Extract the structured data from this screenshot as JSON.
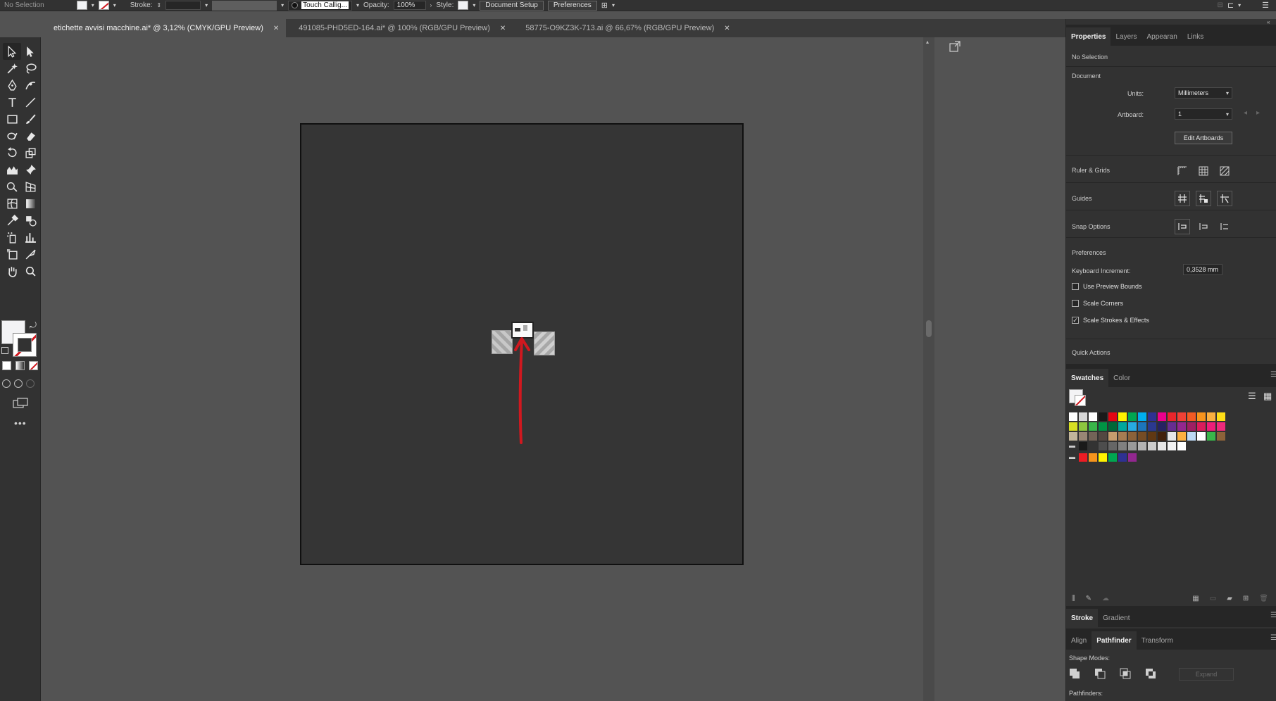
{
  "control_bar": {
    "selection": "No Selection",
    "stroke_label": "Stroke:",
    "brush_label": "Touch Callig...",
    "opacity_label": "Opacity:",
    "opacity_value": "100%",
    "style_label": "Style:",
    "document_setup": "Document Setup",
    "preferences": "Preferences"
  },
  "tabs": [
    {
      "label": "etichette avvisi macchine.ai* @ 3,12% (CMYK/GPU Preview)",
      "active": true
    },
    {
      "label": "491085-PHD5ED-164.ai* @ 100% (RGB/GPU Preview)",
      "active": false
    },
    {
      "label": "58775-O9KZ3K-713.ai @ 66,67% (RGB/GPU Preview)",
      "active": false
    }
  ],
  "panel": {
    "tabs": [
      "Properties",
      "Layers",
      "Appearan",
      "Links"
    ],
    "selection_status": "No Selection",
    "document_title": "Document",
    "units_label": "Units:",
    "units_value": "Millimeters",
    "artboard_label": "Artboard:",
    "artboard_value": "1",
    "edit_artboards": "Edit Artboards",
    "ruler_grids": "Ruler & Grids",
    "guides": "Guides",
    "snap_options": "Snap Options",
    "preferences_title": "Preferences",
    "keyboard_increment_label": "Keyboard Increment:",
    "keyboard_increment_value": "0,3528 mm",
    "use_preview_bounds": "Use Preview Bounds",
    "scale_corners": "Scale Corners",
    "scale_strokes": "Scale Strokes & Effects",
    "quick_actions": "Quick Actions",
    "swatches_tabs": [
      "Swatches",
      "Color"
    ],
    "stroke_tabs": [
      "Stroke",
      "Gradient"
    ],
    "pathfinder_tabs": [
      "Align",
      "Pathfinder",
      "Transform"
    ],
    "shape_modes": "Shape Modes:",
    "expand": "Expand",
    "pathfinders": "Pathfinders:"
  },
  "checkboxes": {
    "use_preview_bounds": false,
    "scale_corners": false,
    "scale_strokes": true
  },
  "colors": {
    "accent_red": "#d0181f",
    "canvas_bg": "#535353",
    "artboard_bg": "#353535",
    "panel_bg": "#323232"
  },
  "swatches_row1": [
    "#ffffff",
    "#d8d8d8",
    "#ffffff",
    "#1a1a1a",
    "#e30613",
    "#fff200",
    "#00a651",
    "#00aeef",
    "#2e3192",
    "#ec008c",
    "#e8262c",
    "#ef4136",
    "#f15a24",
    "#f7941d",
    "#fbb040",
    "#ffde17"
  ],
  "swatches_row2": [
    "#d7df23",
    "#8dc63f",
    "#39b54a",
    "#009444",
    "#006838",
    "#00a79d",
    "#27aae1",
    "#1c75bc",
    "#2b388f",
    "#262262",
    "#662d91",
    "#92278f",
    "#9e1f63",
    "#da1c5c",
    "#ed1e79",
    "#ee2a7b"
  ],
  "swatches_row3": [
    "#c2b59b",
    "#998675",
    "#736357",
    "#534741",
    "#c69c6d",
    "#a67c52",
    "#8c6239",
    "#754c24",
    "#603813",
    "#42210b",
    "#e6e6e6",
    "#fbb040",
    "#bcd9f3",
    "#ffffff",
    "#39b54a",
    "#8c6239"
  ],
  "swatches_row4": [
    "#1a1a1a",
    "#333333",
    "#4d4d4d",
    "#666666",
    "#808080",
    "#999999",
    "#b3b3b3",
    "#cccccc",
    "#e6e6e6",
    "#f2f2f2",
    "#ffffff"
  ],
  "swatches_row5": [
    "#ed1c24",
    "#f7941d",
    "#fff200",
    "#00a651",
    "#2e3192",
    "#92278f"
  ]
}
